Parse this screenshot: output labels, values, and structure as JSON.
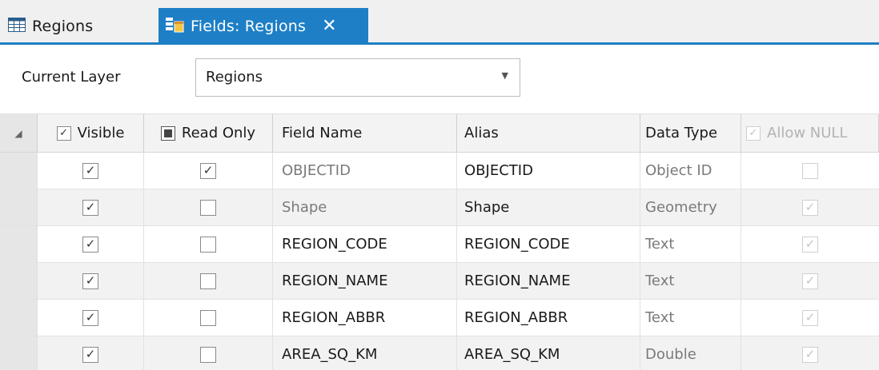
{
  "tabs": {
    "regions": {
      "label": "Regions",
      "icon": "table-icon"
    },
    "fields": {
      "label": "Fields:  Regions",
      "icon": "fields-view-icon",
      "close_glyph": "✕"
    }
  },
  "layer_selector": {
    "label": "Current Layer",
    "value": "Regions"
  },
  "columns": {
    "visible": "Visible",
    "read_only": "Read Only",
    "field_name": "Field Name",
    "alias": "Alias",
    "data_type": "Data Type",
    "allow_null": "Allow NULL"
  },
  "rows": [
    {
      "visible": true,
      "read_only": true,
      "field_name": "OBJECTID",
      "alias": "OBJECTID",
      "data_type": "Object ID",
      "allow_null": false
    },
    {
      "visible": true,
      "read_only": false,
      "field_name": "Shape",
      "alias": "Shape",
      "data_type": "Geometry",
      "allow_null": true
    },
    {
      "visible": true,
      "read_only": false,
      "field_name": "REGION_CODE",
      "alias": "REGION_CODE",
      "data_type": "Text",
      "allow_null": true
    },
    {
      "visible": true,
      "read_only": false,
      "field_name": "REGION_NAME",
      "alias": "REGION_NAME",
      "data_type": "Text",
      "allow_null": true
    },
    {
      "visible": true,
      "read_only": false,
      "field_name": "REGION_ABBR",
      "alias": "REGION_ABBR",
      "data_type": "Text",
      "allow_null": true
    },
    {
      "visible": true,
      "read_only": false,
      "field_name": "AREA_SQ_KM",
      "alias": "AREA_SQ_KM",
      "data_type": "Double",
      "allow_null": true
    }
  ],
  "colors": {
    "accent": "#1e7fc6",
    "alt_row": "#f2f2f2",
    "header_bg": "#f3f3f3"
  }
}
